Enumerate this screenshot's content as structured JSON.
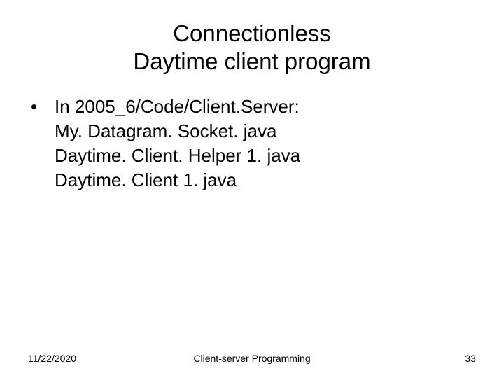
{
  "title_line1": "Connectionless",
  "title_line2": "Daytime client program",
  "bullet_lead": "In 2005_6/Code/Client.Server:",
  "lines": {
    "l1": "My. Datagram. Socket. java",
    "l2": "Daytime. Client. Helper 1. java",
    "l3": "Daytime. Client 1. java"
  },
  "footer": {
    "date": "11/22/2020",
    "center": "Client-server Programming",
    "page": "33"
  }
}
